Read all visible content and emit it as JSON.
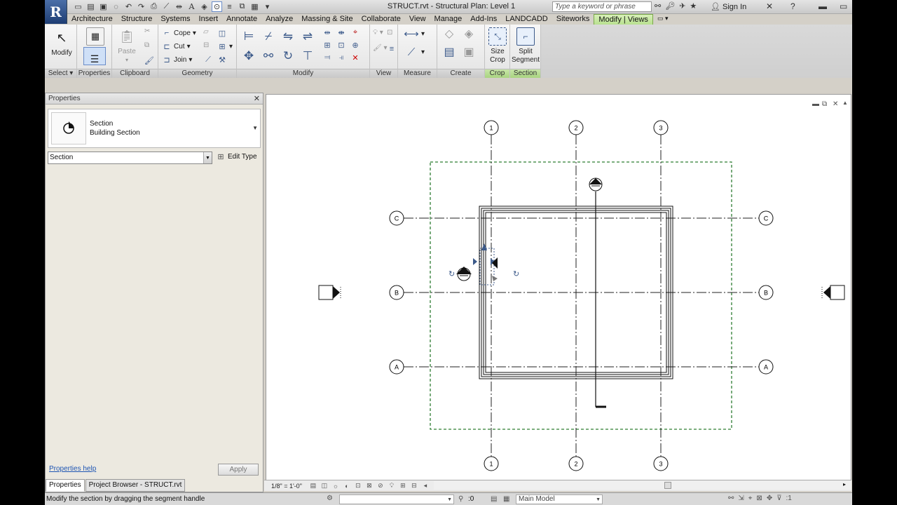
{
  "app": {
    "logo": "R",
    "document_title": "STRUCT.rvt - Structural Plan: Level 1",
    "search_placeholder": "Type a keyword or phrase",
    "sign_in": "Sign In"
  },
  "tabs": [
    {
      "label": "Architecture"
    },
    {
      "label": "Structure"
    },
    {
      "label": "Systems"
    },
    {
      "label": "Insert"
    },
    {
      "label": "Annotate"
    },
    {
      "label": "Analyze"
    },
    {
      "label": "Massing & Site"
    },
    {
      "label": "Collaborate"
    },
    {
      "label": "View"
    },
    {
      "label": "Manage"
    },
    {
      "label": "Add-Ins"
    },
    {
      "label": "LANDCADD"
    },
    {
      "label": "Siteworks"
    },
    {
      "label": "Modify | Views"
    }
  ],
  "ribbon": {
    "modify_label": "Modify",
    "paste_label": "Paste",
    "cope_label": "Cope",
    "cut_label": "Cut",
    "join_label": "Join",
    "size_crop_label_1": "Size",
    "size_crop_label_2": "Crop",
    "split_segment_label_1": "Split",
    "split_segment_label_2": "Segment",
    "panels": {
      "select": "Select",
      "properties": "Properties",
      "clipboard": "Clipboard",
      "geometry": "Geometry",
      "modify": "Modify",
      "view": "View",
      "measure": "Measure",
      "create": "Create",
      "crop": "Crop",
      "section": "Section"
    }
  },
  "properties": {
    "title": "Properties",
    "type_family": "Section",
    "type_name": "Building Section",
    "instance_filter": "Section",
    "edit_type": "Edit Type",
    "help_link": "Properties help",
    "apply": "Apply",
    "tab_properties": "Properties",
    "tab_browser": "Project Browser - STRUCT.rvt"
  },
  "drawing": {
    "grid_columns": [
      "1",
      "2",
      "3"
    ],
    "grid_rows": [
      "C",
      "B",
      "A"
    ]
  },
  "view_control": {
    "scale": "1/8\" = 1'-0\""
  },
  "status": {
    "message": "Modify the section by dragging the segment handle",
    "selection_count": ":0",
    "workset": "Main Model",
    "filter_count": ":1"
  },
  "colors": {
    "context_tab": "#b8e090",
    "link": "#1e55b3",
    "crop_boundary": "#2e7d32"
  }
}
